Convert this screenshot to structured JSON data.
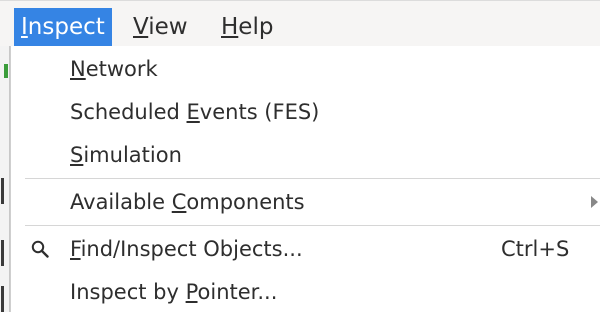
{
  "menubar": {
    "items": [
      {
        "mnemonic": "I",
        "rest": "nspect",
        "active": true
      },
      {
        "mnemonic": "V",
        "rest": "iew",
        "active": false
      },
      {
        "mnemonic": "H",
        "rest": "elp",
        "active": false
      }
    ]
  },
  "menu": {
    "network": {
      "mnemonic": "N",
      "rest": "etwork"
    },
    "scheduled_events": {
      "pre": "Scheduled ",
      "mnemonic": "E",
      "rest": "vents (FES)"
    },
    "simulation": {
      "mnemonic": "S",
      "rest": "imulation"
    },
    "available_components": {
      "pre": "Available ",
      "mnemonic": "C",
      "rest": "omponents",
      "has_submenu": true
    },
    "find_inspect": {
      "mnemonic": "F",
      "rest": "ind/Inspect Objects...",
      "shortcut": "Ctrl+S",
      "icon": "search-icon"
    },
    "inspect_by_pointer": {
      "pre": "Inspect by ",
      "mnemonic": "P",
      "rest": "ointer..."
    }
  },
  "colors": {
    "accent": "#3584e4",
    "menu_text": "#2e2e2e",
    "active_text": "#ffffff"
  }
}
